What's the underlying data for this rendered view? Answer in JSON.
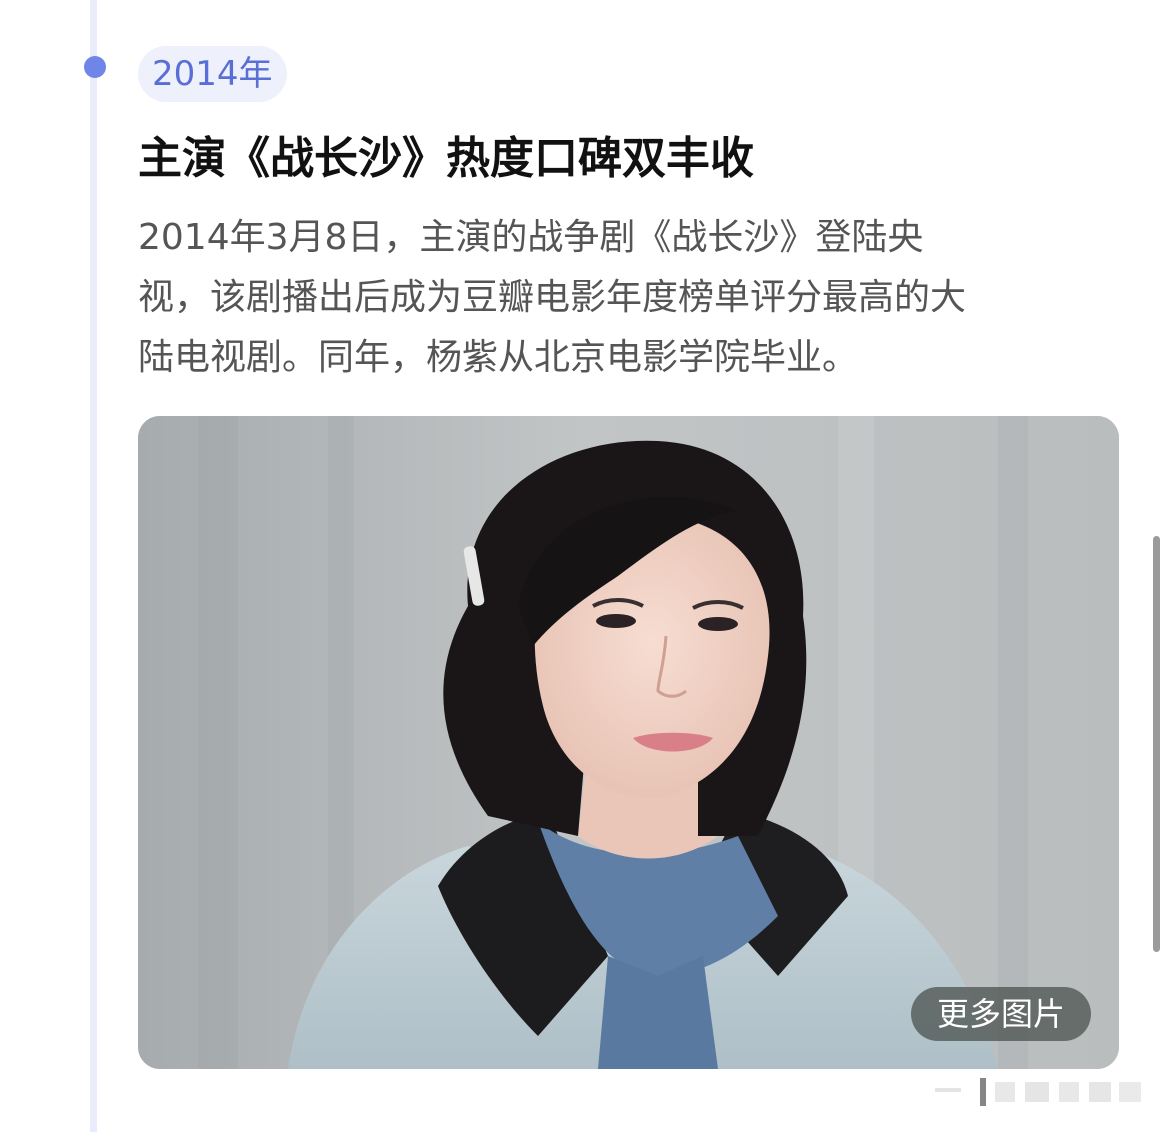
{
  "timeline": {
    "entry": {
      "year": "2014年",
      "title": "主演《战长沙》热度口碑双丰收",
      "description_lines": [
        "2014年3月8日，主演的战争剧《战长沙》登陆央",
        "视，该剧播出后成为豆瓣电影年度榜单评分最高的大",
        "陆电视剧。同年，杨紫从北京电影学院毕业。"
      ],
      "photo": {
        "more_label": "更多图片"
      }
    }
  },
  "colors": {
    "accent": "#5a6fd6",
    "timeline_dot": "#6f85e8",
    "timeline_line": "#e9ecfb",
    "badge_bg": "#eef1fc",
    "title_text": "#111111",
    "body_text": "#555555"
  },
  "icons": {
    "timeline_dot": "timeline-dot-icon"
  }
}
